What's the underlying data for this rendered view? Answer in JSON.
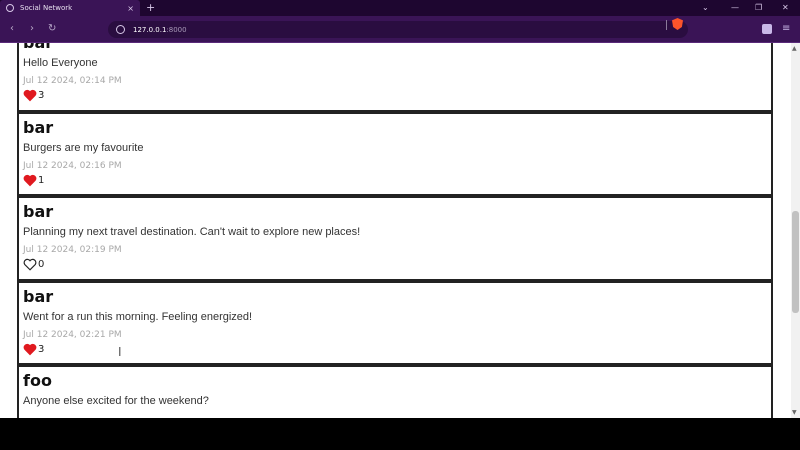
{
  "browser": {
    "tab_title": "Social Network",
    "tab_close": "×",
    "new_tab": "+",
    "url_host": "127.0.0.1",
    "url_port": ":8000",
    "icons": [
      "globe-icon",
      "shield-icon",
      "wallet-icon",
      "menu-icon"
    ],
    "accent": "#3a1456"
  },
  "window_controls": {
    "dropdown": "⌄",
    "minimize": "—",
    "restore": "❐",
    "close": "✕"
  },
  "nav": {
    "back": "‹",
    "forward": "›",
    "reload": "↻",
    "menu": "≡"
  },
  "posts": [
    {
      "author": "bar",
      "body": "Hello Everyone",
      "time": "Jul 12 2024, 02:14 PM",
      "liked": true,
      "likes": "3"
    },
    {
      "author": "bar",
      "body": "Burgers are my favourite",
      "time": "Jul 12 2024, 02:16 PM",
      "liked": true,
      "likes": "1"
    },
    {
      "author": "bar",
      "body": "Planning my next travel destination. Can't wait to explore new places!",
      "time": "Jul 12 2024, 02:19 PM",
      "liked": false,
      "likes": "0"
    },
    {
      "author": "bar",
      "body": "Went for a run this morning. Feeling energized!",
      "time": "Jul 12 2024, 02:21 PM",
      "liked": true,
      "likes": "3"
    },
    {
      "author": "foo",
      "body": "Anyone else excited for the weekend?",
      "time": "",
      "liked": false,
      "likes": ""
    }
  ],
  "colors": {
    "heart": "#e0191f",
    "border": "#222222",
    "timestamp": "#a8a8a8"
  },
  "scrollbar": {
    "position_percent": 45,
    "up_arrow": "▲",
    "down_arrow": "▼"
  }
}
